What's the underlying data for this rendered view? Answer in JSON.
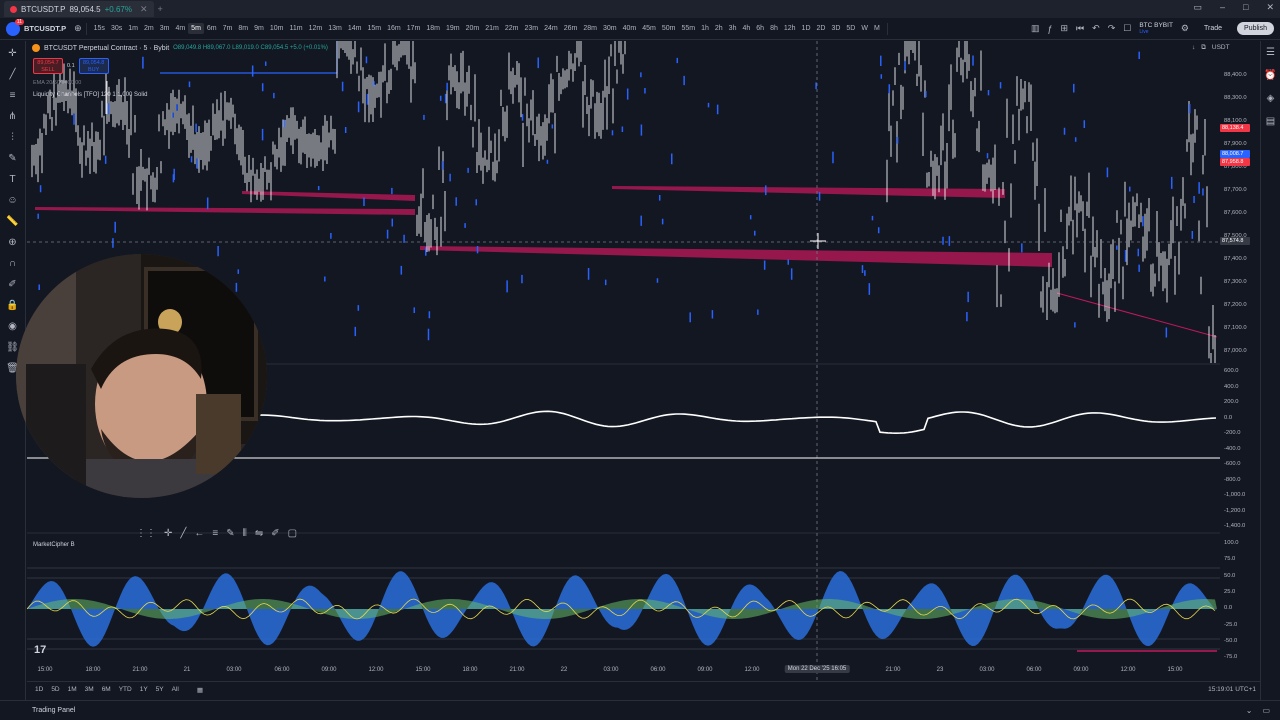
{
  "browser": {
    "tab_title": "BTCUSDT.P",
    "tab_price": "89,054.5",
    "tab_change": "+0.67%",
    "notif_count": "11"
  },
  "toolbar": {
    "symbol": "BTCUSDT.P",
    "intervals": [
      "15s",
      "30s",
      "1m",
      "2m",
      "3m",
      "4m",
      "5m",
      "6m",
      "7m",
      "8m",
      "9m",
      "10m",
      "11m",
      "12m",
      "13m",
      "14m",
      "15m",
      "16m",
      "17m",
      "18m",
      "19m",
      "20m",
      "21m",
      "22m",
      "23m",
      "24m",
      "26m",
      "28m",
      "30m",
      "40m",
      "45m",
      "50m",
      "55m",
      "1h",
      "2h",
      "3h",
      "4h",
      "6h",
      "8h",
      "12h",
      "1D",
      "2D",
      "3D",
      "5D",
      "W",
      "M"
    ],
    "active_interval": "5m",
    "broker_line1": "BTC BYBIT",
    "broker_line2": "Live",
    "trade_label": "Trade",
    "publish_label": "Publish"
  },
  "legend": {
    "title": "BTCUSDT Perpetual Contract · 5 · Bybit",
    "ohlc": "O89,049.8 H89,067.0 L89,019.0 C89,054.5 +5.0 (+0.01%)",
    "sell_price": "89,054.7",
    "sell_label": "SELL",
    "spread": "0.1",
    "buy_price": "89,054.8",
    "buy_label": "BUY",
    "indicator1": "EMA 20/50/100/200",
    "indicator2": "Liquidity Channels [TFO] 120 1 1,000 Solid",
    "indicator3": "MarketCipher B"
  },
  "price_scale": {
    "currency": "USDT",
    "labels": [
      "88,400.0",
      "88,300.0",
      "88,100.0",
      "87,900.0",
      "87,800.0",
      "87,700.0",
      "87,600.0",
      "87,500.0",
      "87,400.0",
      "87,300.0",
      "87,200.0",
      "87,100.0",
      "87,000.0"
    ],
    "tags": [
      {
        "text": "88,138.4",
        "color": "#f23645"
      },
      {
        "text": "88,008.7",
        "color": "#2962ff"
      },
      {
        "text": "87,958.8",
        "color": "#f23645"
      },
      {
        "text": "87,574.8",
        "color": "#363a45"
      }
    ],
    "osc_labels": [
      "600.0",
      "400.0",
      "200.0",
      "0.0",
      "-200.0",
      "-400.0",
      "-600.0",
      "-800.0",
      "-1,000.0",
      "-1,200.0",
      "-1,400.0"
    ],
    "mcb_labels": [
      "100.0",
      "75.0",
      "50.0",
      "25.0",
      "0.0",
      "-25.0",
      "-50.0",
      "-75.0"
    ]
  },
  "time_axis": {
    "labels": [
      "15:00",
      "18:00",
      "21:00",
      "21",
      "03:00",
      "06:00",
      "09:00",
      "12:00",
      "15:00",
      "18:00",
      "21:00",
      "22",
      "03:00",
      "06:00",
      "09:00",
      "12:00",
      "Mon 22 Dec '25  16:05",
      "21:00",
      "23",
      "03:00",
      "06:00",
      "09:00",
      "12:00",
      "15:00"
    ],
    "highlight_index": 16
  },
  "range_bar": {
    "ranges": [
      "1D",
      "5D",
      "1M",
      "3M",
      "6M",
      "YTD",
      "1Y",
      "5Y",
      "All"
    ],
    "clock": "15:19:01 UTC+1"
  },
  "bottom_panel": {
    "label": "Trading Panel"
  },
  "watermark": "17",
  "colors": {
    "background": "#131722",
    "candle": "#ffffff",
    "candle_blue": "#2962ff",
    "liquidity_zone": "#c2185b",
    "oscillator": "#ffffff",
    "wave_blue": "#2a6edb",
    "wave_green": "#66bb6a",
    "wave_yellow": "#e6d84a"
  },
  "icons": [
    "search-icon",
    "crosshair-icon",
    "trend-line-icon",
    "fib-icon",
    "brush-icon",
    "text-icon",
    "emoji-icon",
    "ruler-icon",
    "zoom-icon",
    "magnet-icon",
    "lock-icon",
    "eye-icon",
    "link-icon",
    "trash-icon"
  ]
}
